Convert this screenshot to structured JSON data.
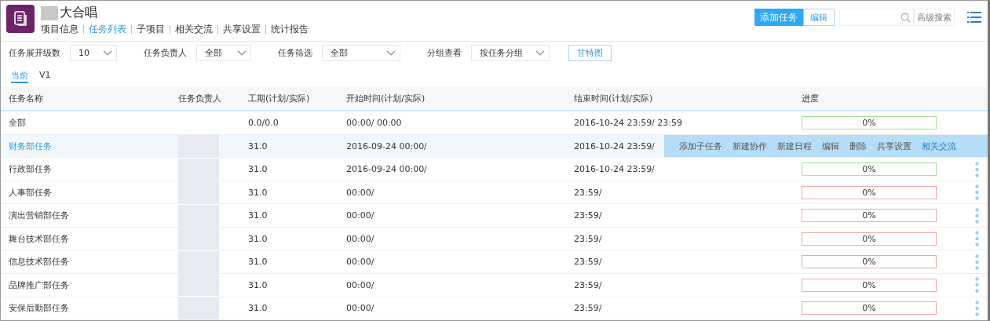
{
  "project": {
    "title": "大合唱"
  },
  "nav_tabs": [
    {
      "label": "项目信息",
      "selected": false
    },
    {
      "label": "任务列表",
      "selected": true
    },
    {
      "label": "子项目",
      "selected": false
    },
    {
      "label": "相关交流",
      "selected": false
    },
    {
      "label": "共享设置",
      "selected": false
    },
    {
      "label": "统计报告",
      "selected": false
    }
  ],
  "toolbar": {
    "add_button": "添加任务",
    "edit_button": "编辑",
    "advanced_search": "高级搜索"
  },
  "filters": [
    {
      "label": "任务展开级数",
      "value": "10"
    },
    {
      "label": "任务负责人",
      "value": "全部"
    },
    {
      "label": "任务筛选",
      "value": "全部"
    },
    {
      "label": "分组查看",
      "value": "按任务分组"
    }
  ],
  "gantt_button": "甘特图",
  "versions": [
    {
      "label": "当前",
      "selected": true
    },
    {
      "label": "V1",
      "selected": false
    }
  ],
  "table": {
    "columns": [
      "任务名称",
      "任务负责人",
      "工期(计划/实际)",
      "开始时间(计划/实际)",
      "结束时间(计划/实际)",
      "进度"
    ],
    "rows": [
      {
        "name": "全部",
        "duration": "0.0/0.0",
        "start": "00:00/ 00:00",
        "end": "2016-10-24 23:59/ 23:59",
        "progress": "0%",
        "overdue": false,
        "hovered": false,
        "menu": false
      },
      {
        "name": "财务部任务",
        "duration": "31.0",
        "start": "2016-09-24 00:00/",
        "end": "2016-10-24 23:59/",
        "hovered": true
      },
      {
        "name": "行政部任务",
        "duration": "31.0",
        "start": "2016-09-24 00:00/",
        "end": "2016-10-24 23:59/",
        "progress": "0%",
        "overdue": false,
        "hovered": false,
        "menu": true
      },
      {
        "name": "人事部任务",
        "duration": "31.0",
        "start": "00:00/",
        "end": "23:59/",
        "progress": "0%",
        "overdue": true,
        "hovered": false,
        "menu": true
      },
      {
        "name": "演出营销部任务",
        "duration": "31.0",
        "start": "00:00/",
        "end": "23:59/",
        "progress": "0%",
        "overdue": true,
        "hovered": false,
        "menu": true
      },
      {
        "name": "舞台技术部任务",
        "duration": "31.0",
        "start": "00:00/",
        "end": "23:59/",
        "progress": "0%",
        "overdue": true,
        "hovered": false,
        "menu": true
      },
      {
        "name": "信息技术部任务",
        "duration": "31.0",
        "start": "00:00/",
        "end": "23:59/",
        "progress": "0%",
        "overdue": true,
        "hovered": false,
        "menu": true
      },
      {
        "name": "品牌推广部任务",
        "duration": "31.0",
        "start": "00:00/",
        "end": "23:59/",
        "progress": "0%",
        "overdue": true,
        "hovered": false,
        "menu": true
      },
      {
        "name": "安保后勤部任务",
        "duration": "31.0",
        "start": "00:00/",
        "end": "23:59/",
        "progress": "0%",
        "overdue": true,
        "hovered": false,
        "menu": true
      }
    ]
  },
  "row_actions": [
    "添加子任务",
    "新建协作",
    "新建日程",
    "编辑",
    "删除",
    "共享设置",
    "相关交流"
  ]
}
